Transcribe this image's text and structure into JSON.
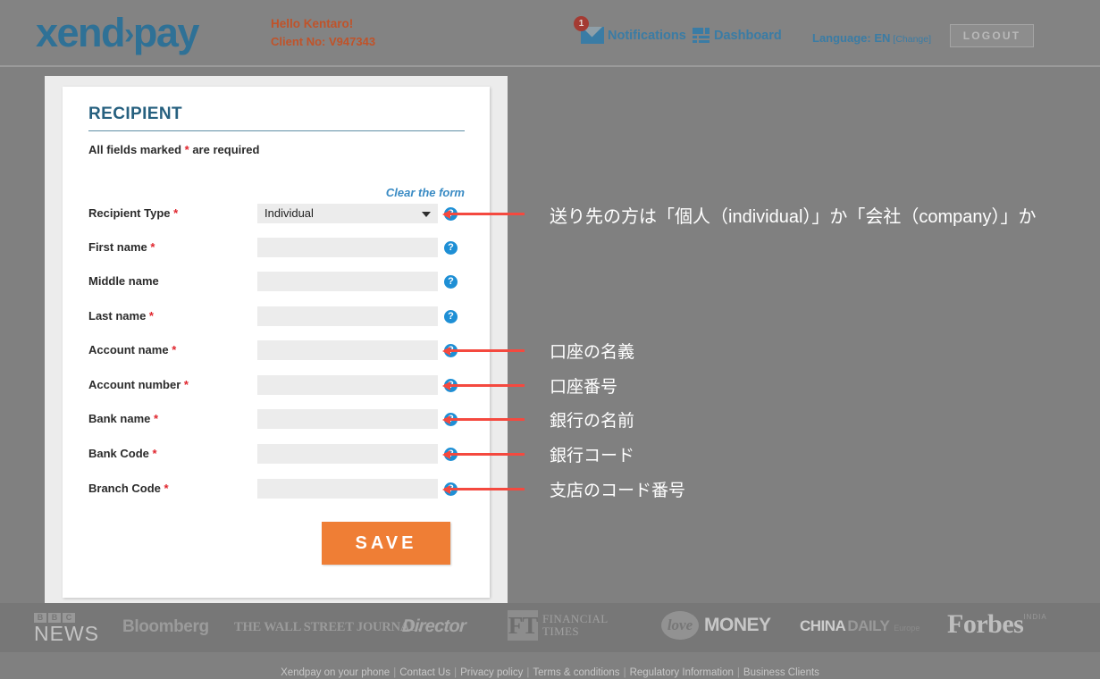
{
  "header": {
    "logo": "xend",
    "logo_chevron": "›",
    "logo_suffix": "pay",
    "hello": "Hello Kentaro!",
    "client_no": "Client No: V947343",
    "notifications_label": "Notifications",
    "notifications_badge": "1",
    "dashboard_label": "Dashboard",
    "language_label": "Language: EN",
    "language_change": "[Change]",
    "logout_label": "LOGOUT"
  },
  "form": {
    "title": "RECIPIENT",
    "required_note_before": "All fields marked ",
    "required_star": "*",
    "required_note_after": " are required",
    "clear_form": "Clear the form",
    "save_label": "SAVE",
    "help_glyph": "?",
    "rows": [
      {
        "label": "Recipient Type",
        "required": true,
        "type": "select",
        "value": "Individual"
      },
      {
        "label": "First name",
        "required": true,
        "type": "text",
        "value": ""
      },
      {
        "label": "Middle name",
        "required": false,
        "type": "text",
        "value": ""
      },
      {
        "label": "Last name",
        "required": true,
        "type": "text",
        "value": ""
      },
      {
        "label": "Account name",
        "required": true,
        "type": "text",
        "value": ""
      },
      {
        "label": "Account number",
        "required": true,
        "type": "text",
        "value": ""
      },
      {
        "label": "Bank name",
        "required": true,
        "type": "text",
        "value": ""
      },
      {
        "label": "Bank Code",
        "required": true,
        "type": "text",
        "value": ""
      },
      {
        "label": "Branch Code",
        "required": true,
        "type": "text",
        "value": ""
      }
    ]
  },
  "annotations": [
    {
      "text": "送り先の方は「個人（individual）」か「会社（company）」か",
      "row": 0
    },
    {
      "text": "口座の名義",
      "row": 4
    },
    {
      "text": "口座番号",
      "row": 5
    },
    {
      "text": "銀行の名前",
      "row": 6
    },
    {
      "text": "銀行コード",
      "row": 7
    },
    {
      "text": "支店のコード番号",
      "row": 8
    }
  ],
  "press": {
    "bbc_blocks": [
      "B",
      "B",
      "C"
    ],
    "bbc_news": "NEWS",
    "bloomberg": "Bloomberg",
    "wsj": "THE WALL STREET JOURNAL.",
    "director": "Director",
    "ft_mark": "FT",
    "ft_line1": "FINANCIAL",
    "ft_line2": "TIMES",
    "love": "love",
    "money": "MONEY",
    "china": "CHINA",
    "daily": "DAILY",
    "europe": "Europe",
    "forbes": "Forbes",
    "forbes_sub": "INDIA"
  },
  "footer_links": [
    "Xendpay on your phone",
    "Contact Us",
    "Privacy policy",
    "Terms & conditions",
    "Regulatory Information",
    "Business Clients"
  ],
  "colors": {
    "page_bg": "#808080",
    "header_bg": "#838383",
    "logo_blue": "#2f7196",
    "accent_orange": "#ef7e35",
    "title_blue": "#26607f",
    "link_blue": "#3a8bc4",
    "required_red": "#e0252d",
    "annotation_red": "#f4493f",
    "help_blue": "#1e8fd5",
    "badge_red": "#a43b33"
  }
}
